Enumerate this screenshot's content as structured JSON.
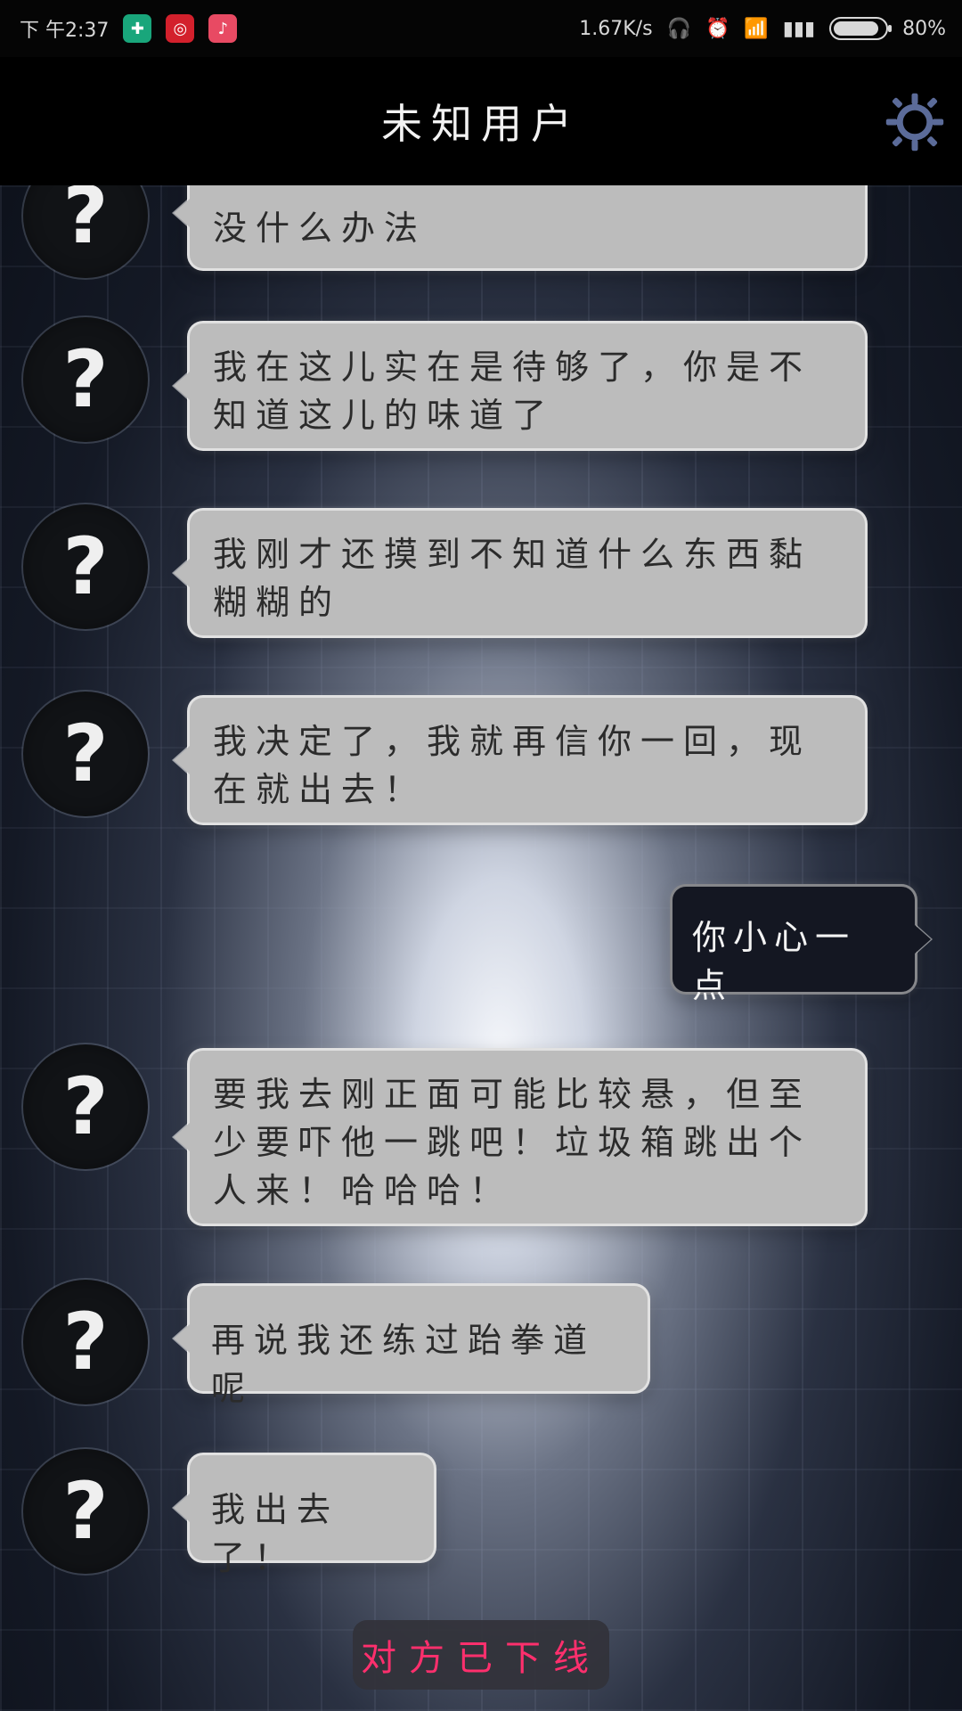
{
  "status_bar": {
    "time": "下 午2:37",
    "net_speed": "1.67K/s",
    "battery_percent": "80%",
    "app_icons": [
      "shield-app-icon",
      "netease-music-icon",
      "tiktok-icon"
    ],
    "system_icons": [
      "headphones-icon",
      "alarm-icon",
      "wifi-icon",
      "signal-icon",
      "battery-icon"
    ]
  },
  "header": {
    "title": "未知用户",
    "settings_icon": "gear-icon",
    "gear_color": "#5b6b99"
  },
  "messages": [
    {
      "sender": "other",
      "avatar_text": "?",
      "text": "没什么办法"
    },
    {
      "sender": "other",
      "avatar_text": "?",
      "text": "我在这儿实在是待够了，你是不知道这儿的味道了"
    },
    {
      "sender": "other",
      "avatar_text": "?",
      "text": "我刚才还摸到不知道什么东西黏糊糊的"
    },
    {
      "sender": "other",
      "avatar_text": "?",
      "text": "我决定了，我就再信你一回，现在就出去！"
    },
    {
      "sender": "me",
      "text": "你小心一点"
    },
    {
      "sender": "other",
      "avatar_text": "?",
      "text": "要我去刚正面可能比较悬，但至少要吓他一跳吧！垃圾箱跳出个人来！哈哈哈！"
    },
    {
      "sender": "other",
      "avatar_text": "?",
      "text": "再说我还练过跆拳道呢"
    },
    {
      "sender": "other",
      "avatar_text": "?",
      "text": "我出去了！"
    }
  ],
  "footer": {
    "offline_text": "对方已下线",
    "offline_color": "#ff2f6d"
  }
}
